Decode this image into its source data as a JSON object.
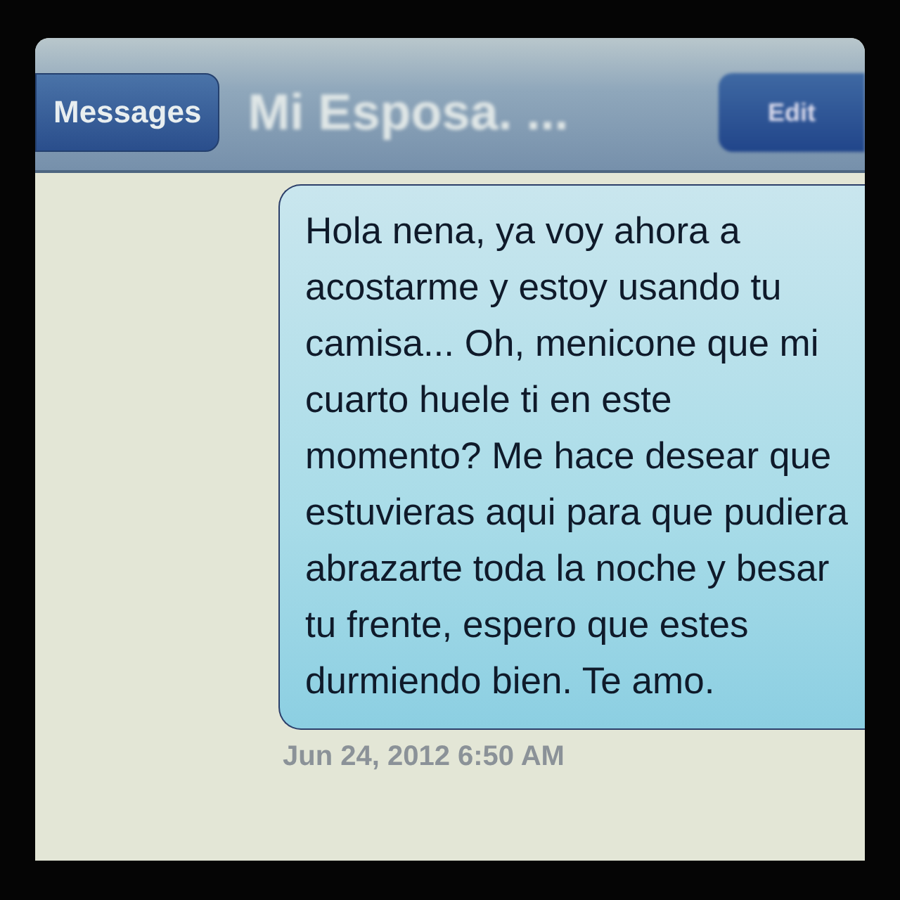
{
  "nav_bar": {
    "back_button": "Messages",
    "title": "Mi Esposa. ...",
    "edit_button": "Edit"
  },
  "messages": [
    {
      "text": "Hola nena, ya voy ahora a acostarme y estoy usando tu camisa... Oh, menicone que mi cuarto huele ti en este momento? Me hace desear que estuvieras aqui para que pudiera abrazarte toda la noche y besar tu frente, espero que estes durmiendo bien. Te amo.",
      "timestamp": "Jun 24, 2012 6:50 AM"
    }
  ]
}
